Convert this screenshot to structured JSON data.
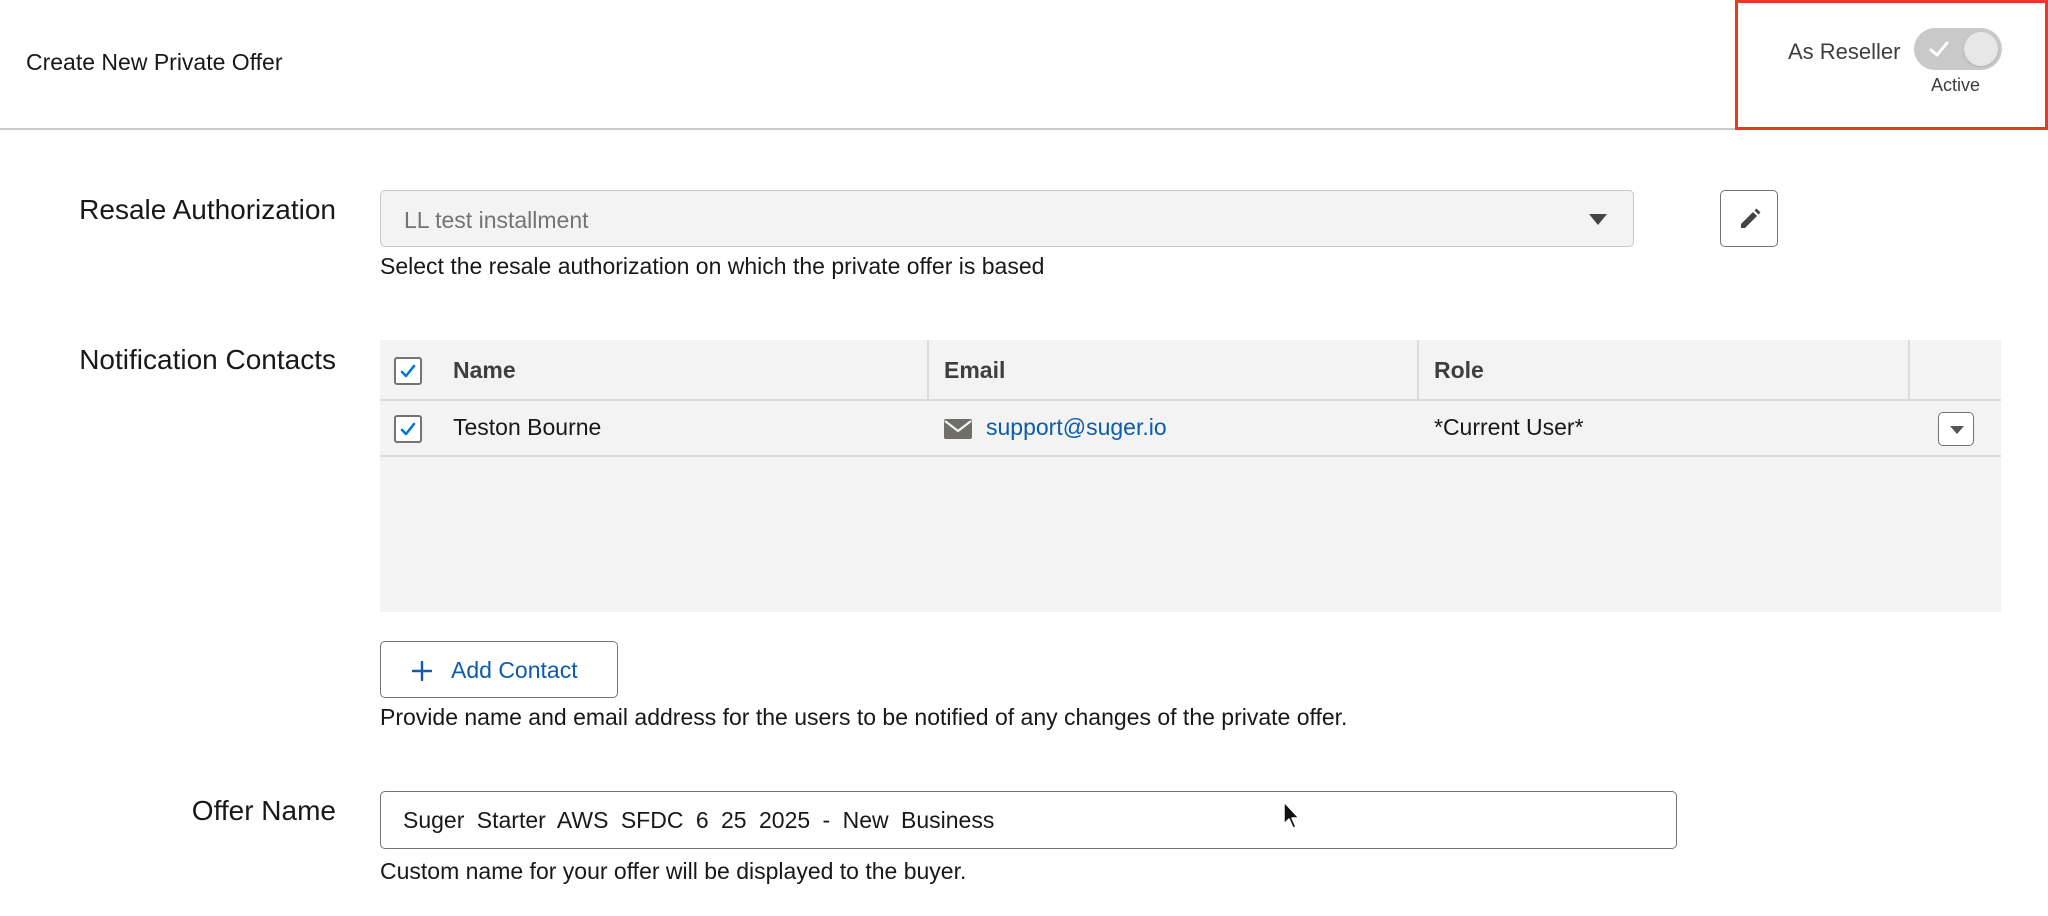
{
  "header": {
    "title": "Create New Private Offer",
    "reseller_label": "As Reseller",
    "toggle_state": "Active",
    "toggle_on": true,
    "highlight_color": "#e8382a"
  },
  "resale_authorization": {
    "label": "Resale Authorization",
    "selected_value": "LL test installment",
    "help_text": "Select the resale authorization on which the private offer is based",
    "edit_icon": "pencil-icon"
  },
  "notification_contacts": {
    "label": "Notification Contacts",
    "columns": [
      "Name",
      "Email",
      "Role"
    ],
    "rows": [
      {
        "checked": true,
        "name": "Teston Bourne",
        "email": "support@suger.io",
        "role": "*Current User*"
      }
    ],
    "add_button_label": "Add Contact",
    "help_text": "Provide name and email address for the users to be notified of any changes of the private offer."
  },
  "offer_name": {
    "label": "Offer Name",
    "value": "Suger Starter AWS SFDC 6 25 2025 - New Business",
    "help_text": "Custom name for your offer will be displayed to the buyer."
  },
  "colors": {
    "link": "#0b5cab",
    "checkbox": "#0176d3",
    "table_bg": "#f3f3f3"
  }
}
